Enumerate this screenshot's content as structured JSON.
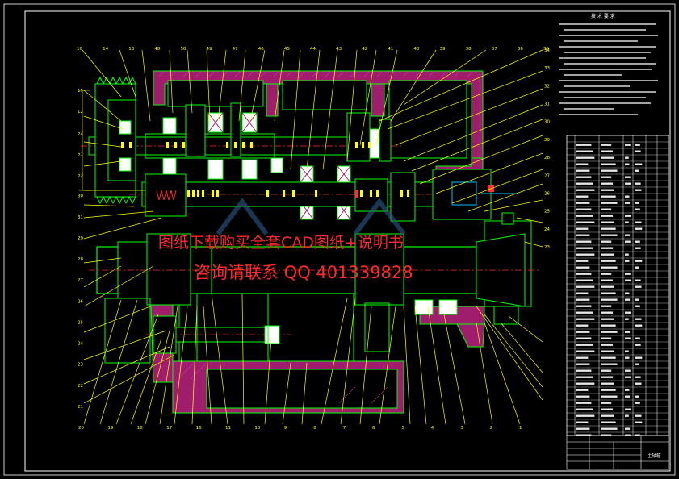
{
  "drawing": {
    "notes_title": "技 术 要 求",
    "title_block_name": "主轴箱",
    "colors": {
      "background": "#000000",
      "outline": "#00ff00",
      "leader": "#ffff00",
      "hatch": "#b0207a",
      "centerline": "#ff3030",
      "part_fill": "#ffffff",
      "detail": "#00c0ff",
      "frame": "#ffffff"
    },
    "balloons_top": [
      "16",
      "14",
      "13",
      "48",
      "50",
      "49",
      "47",
      "46",
      "45",
      "44",
      "43",
      "42",
      "41",
      "40",
      "39",
      "38",
      "37",
      "36",
      "35"
    ],
    "balloons_left": [
      "15",
      "12",
      "52",
      "51",
      "53",
      "30",
      "31",
      "29",
      "28",
      "27",
      "26",
      "25",
      "24",
      "23",
      "22",
      "21"
    ],
    "balloons_bottom": [
      "20",
      "19",
      "18",
      "17",
      "16",
      "11",
      "10",
      "9",
      "8",
      "7",
      "6",
      "5",
      "4",
      "3",
      "2",
      "1"
    ],
    "balloons_right": [
      "34",
      "33",
      "32",
      "31",
      "30",
      "29",
      "28",
      "27",
      "26",
      "25",
      "24",
      "23"
    ],
    "watermark_line1": "图纸下载购买全套CAD图纸+说明书",
    "watermark_line2": "咨询请联系 QQ 401339828"
  }
}
